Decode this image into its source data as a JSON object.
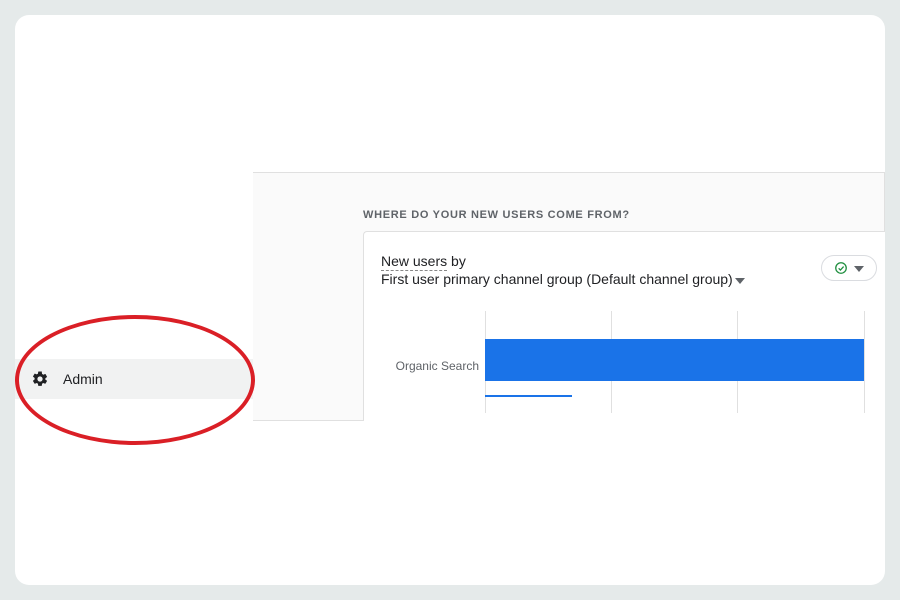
{
  "sidebar": {
    "admin_label": "Admin"
  },
  "card": {
    "heading": "WHERE DO YOUR NEW USERS COME FROM?",
    "title_metric": "New users",
    "title_by": " by",
    "dimension": "First user primary channel group (Default channel group)"
  },
  "status": {
    "icon": "check-circle"
  },
  "chart_data": {
    "type": "bar",
    "orientation": "horizontal",
    "categories": [
      "Organic Search"
    ],
    "values": [
      300
    ],
    "xlim": [
      0,
      300
    ],
    "title": "",
    "xlabel": "",
    "ylabel": ""
  },
  "colors": {
    "bar": "#1a73e8",
    "highlight": "#da1f26",
    "check": "#1e8e3e"
  }
}
